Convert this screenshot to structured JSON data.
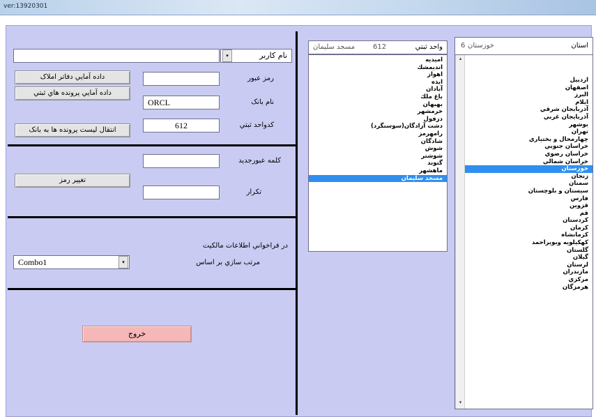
{
  "window": {
    "title": "ver:13920301"
  },
  "login": {
    "username_label": "نام کاربر",
    "password_label": "رمز عبور",
    "bank_name_label": "نام بانک",
    "bank_name_value": "ORCL",
    "unit_code_label": "کدواحد ثبتي",
    "unit_code_value": "612"
  },
  "actions": {
    "property_offices_btn": "داده آمايي دفاتر املاک",
    "registry_files_btn": "داده آمايي پرونده هاي ثبتي",
    "transfer_files_btn": "انتقال ليست پرونده ها به بانک"
  },
  "password_change": {
    "new_password_label": "کلمه عبورجديد",
    "repeat_label": "تکرار",
    "change_btn": "تغيير رمز"
  },
  "ownership": {
    "heading": "در فراخواني اطلاعات مالکيت",
    "sort_label": "مرتب سازي بر اساس",
    "sort_combo_value": "Combo1"
  },
  "exit_btn": "خروج",
  "registry_unit": {
    "label": "واحد ثبتي",
    "code": "612",
    "name": "مسجد سليمان",
    "items": [
      "اميديه",
      "انديمشك",
      "اهواز",
      "ايذه",
      "آبادان",
      "باغ ملك",
      "بهبهان",
      "خرمشهر",
      "دزفول",
      "دشت آزادگان(سوسنگرد)",
      "رامهرمز",
      "شادگان",
      "شوش",
      "شوشتر",
      "گتوند",
      "ماهشهر",
      "مسجد سليمان"
    ],
    "selected_index": 16
  },
  "province": {
    "label": "استان",
    "code": "6",
    "name": "خوزستان",
    "items": [
      "اردبيل",
      "اصفهان",
      "البرز",
      "ايلام",
      "آذربايجان شرقي",
      "آذربايجان غربي",
      "بوشهر",
      "تهران",
      "چهارمحال و بختياري",
      "خراسان جنوبي",
      "خراسان رضوي",
      "خراسان شمالي",
      "خوزستان",
      "زنجان",
      "سمنان",
      "سيستان و بلوچستان",
      "فارس",
      "قزوين",
      "قم",
      "كردستان",
      "كرمان",
      "كرمانشاه",
      "كهكيلويه وبويراحمد",
      "گلستان",
      "گيلان",
      "لرستان",
      "مازندران",
      "مركزي",
      "هرمزگان"
    ],
    "selected_index": 12
  }
}
